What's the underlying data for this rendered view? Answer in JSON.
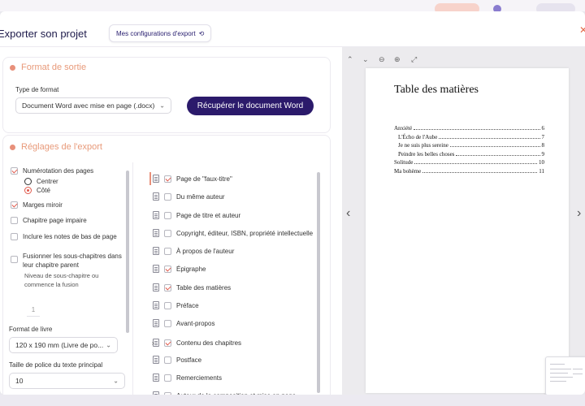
{
  "header": {
    "title": "Exporter son projet",
    "config_button": "Mes configurations d'export"
  },
  "output_format": {
    "title": "Format de sortie",
    "type_label": "Type de format",
    "type_value": "Document Word avec mise en page (.docx)",
    "download_button": "Récupérer le document Word"
  },
  "export_settings": {
    "title": "Réglages de l'export",
    "options": {
      "numbering": {
        "label": "Numérotation des pages",
        "checked": true
      },
      "center": "Centrer",
      "side": "Côté",
      "mirror": {
        "label": "Marges miroir",
        "checked": true
      },
      "odd_chapter": {
        "label": "Chapitre page impaire",
        "checked": false
      },
      "footnotes": {
        "label": "Inclure les notes de bas de page",
        "checked": false
      },
      "merge_sub_line1": "Fusionner les sous-chapitres dans",
      "merge_sub_line2": "leur chapitre parent",
      "sub_level_line1": "Niveau de sous-chapitre ou",
      "sub_level_line2": "commence la fusion",
      "sub_level_value": "1"
    },
    "book_format_label": "Format de livre",
    "book_format_value": "120 x 190 mm (Livre de po...",
    "font_size_label": "Taille de police du texte principal",
    "font_size_value": "10"
  },
  "pages": [
    {
      "label": "Page de \"faux-titre\"",
      "checked": true
    },
    {
      "label": "Du même auteur",
      "checked": false
    },
    {
      "label": "Page de titre et auteur",
      "checked": false
    },
    {
      "label": "Copyright, éditeur, ISBN, propriété intellectuelle",
      "checked": false
    },
    {
      "label": "À propos de l'auteur",
      "checked": false
    },
    {
      "label": "Épigraphe",
      "checked": true
    },
    {
      "label": "Table des matières",
      "checked": true
    },
    {
      "label": "Préface",
      "checked": false
    },
    {
      "label": "Avant-propos",
      "checked": false
    },
    {
      "label": "Contenu des chapitres",
      "checked": true
    },
    {
      "label": "Postface",
      "checked": false
    },
    {
      "label": "Remerciements",
      "checked": false
    },
    {
      "label": "Auteur de la composition et mise en page",
      "checked": true
    }
  ],
  "preview": {
    "toc_title": "Table des matières",
    "entries": [
      {
        "label": "Anxiété",
        "page": "6",
        "indent": false
      },
      {
        "label": "L'Écho de l'Aube",
        "page": "7",
        "indent": true
      },
      {
        "label": "Je ne suis plus sereine",
        "page": "8",
        "indent": true
      },
      {
        "label": "Peindre les belles choses",
        "page": "9",
        "indent": true
      },
      {
        "label": "Solitude",
        "page": "10",
        "indent": false
      },
      {
        "label": "Ma bohème",
        "page": "11",
        "indent": false
      }
    ]
  },
  "colors": {
    "accent": "#e8907a",
    "primary": "#2b1a6b"
  }
}
